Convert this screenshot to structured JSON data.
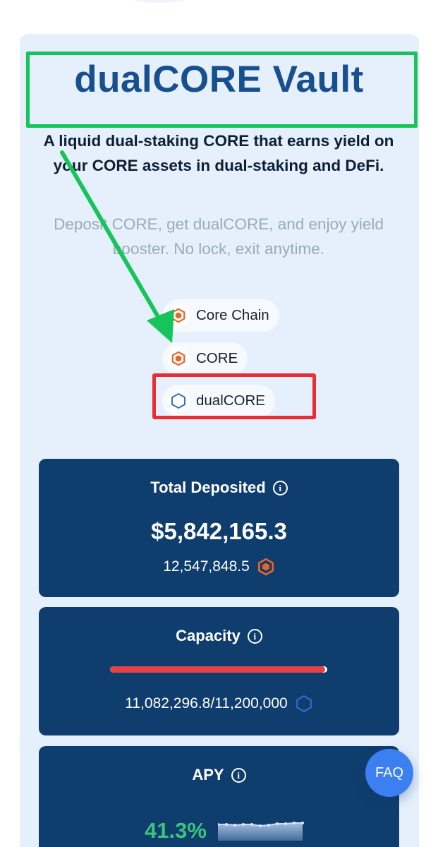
{
  "vault": {
    "title": "dualCORE Vault",
    "subtitle": "A liquid dual-staking CORE that earns yield on your CORE assets in dual-staking and DeFi.",
    "description": "Deposit CORE, get dualCORE, and enjoy yield booster. No lock, exit anytime."
  },
  "chips": [
    {
      "label": "Core Chain",
      "icon": "core-chain-icon"
    },
    {
      "label": "CORE",
      "icon": "core-token-icon"
    },
    {
      "label": "dualCORE",
      "icon": "dualcore-token-icon"
    }
  ],
  "stats": {
    "total_deposited": {
      "label": "Total Deposited",
      "usd_value": "$5,842,165.3",
      "token_value": "12,547,848.5",
      "token_icon": "core-token-icon"
    },
    "capacity": {
      "label": "Capacity",
      "value": "11,082,296.8/11,200,000",
      "fill_fraction": 0.9895,
      "token_icon": "dualcore-token-icon"
    },
    "apy": {
      "label": "APY",
      "value": "41.3%",
      "sparkline_icon": "apy-sparkline"
    }
  },
  "faq_label": "FAQ",
  "colors": {
    "title": "#18508f",
    "card_bg": "#e5f0fc",
    "stat_bg": "#0e3d6e",
    "core_orange": "#e8652a",
    "dualcore_blue": "#2f6fd0",
    "capacity_red": "#e74346",
    "apy_green": "#3ec47a",
    "faq_blue": "#3b7ff0",
    "annotation_green": "#16c45a",
    "annotation_red": "#ea2d33"
  }
}
